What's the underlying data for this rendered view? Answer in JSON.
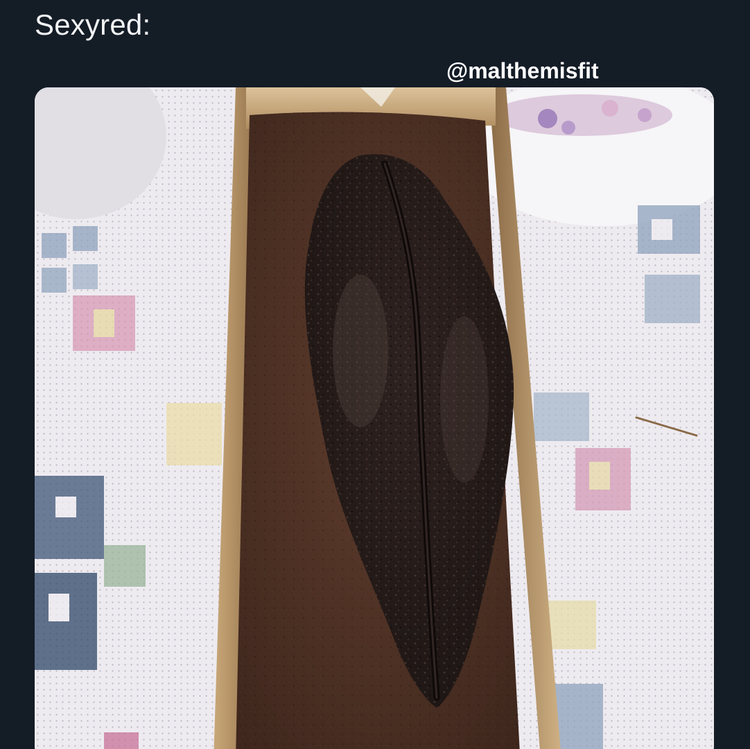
{
  "post": {
    "caption": "Sexyred:",
    "watermark_handle": "@malthemisfit"
  },
  "colors": {
    "background": "#141c26",
    "caption_text": "#f2f4f6",
    "handle_text": "#ffffff"
  },
  "photo": {
    "subject": "chocolate loaf cake in a paper-lined tin on an embroidered tablecloth"
  }
}
